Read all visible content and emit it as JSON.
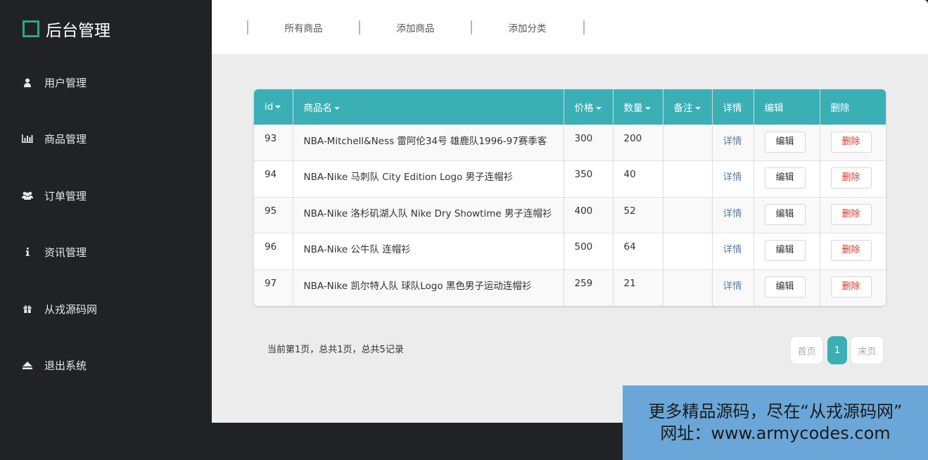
{
  "brand": {
    "title": "后台管理",
    "icon": "square-logo-icon"
  },
  "sidebar": {
    "items": [
      {
        "label": "用户管理",
        "icon": "user-icon"
      },
      {
        "label": "商品管理",
        "icon": "bar-chart-icon"
      },
      {
        "label": "订单管理",
        "icon": "users-icon"
      },
      {
        "label": "资讯管理",
        "icon": "info-icon"
      },
      {
        "label": "从戎源码网",
        "icon": "gift-icon"
      },
      {
        "label": "退出系统",
        "icon": "eject-icon"
      }
    ]
  },
  "topbar": {
    "tabs": [
      "所有商品",
      "添加商品",
      "添加分类"
    ]
  },
  "table": {
    "headers": [
      "id",
      "商品名",
      "价格",
      "数量",
      "备注",
      "详情",
      "编辑",
      "删除"
    ],
    "rows": [
      {
        "id": "93",
        "name": "NBA-Mitchell&Ness 雷阿伦34号 雄鹿队1996-97赛季客",
        "price": "300",
        "qty": "200",
        "note": "",
        "detail": "详情",
        "edit": "编辑",
        "del": "删除"
      },
      {
        "id": "94",
        "name": "NBA-Nike 马刺队 City Edition Logo 男子连帽衫",
        "price": "350",
        "qty": "40",
        "note": "",
        "detail": "详情",
        "edit": "编辑",
        "del": "删除"
      },
      {
        "id": "95",
        "name": "NBA-Nike 洛杉矶湖人队 Nike Dry Showtime 男子连帽衫",
        "price": "400",
        "qty": "52",
        "note": "",
        "detail": "详情",
        "edit": "编辑",
        "del": "删除"
      },
      {
        "id": "96",
        "name": "NBA-Nike 公牛队 连帽衫",
        "price": "500",
        "qty": "64",
        "note": "",
        "detail": "详情",
        "edit": "编辑",
        "del": "删除"
      },
      {
        "id": "97",
        "name": "NBA-Nike 凯尔特人队 球队Logo 黑色男子运动连帽衫",
        "price": "259",
        "qty": "21",
        "note": "",
        "detail": "详情",
        "edit": "编辑",
        "del": "删除"
      }
    ]
  },
  "pagination": {
    "info": "当前第1页，总共1页，总共5记录",
    "first": "首页",
    "current": "1",
    "last": "末页"
  },
  "promo": {
    "line1": "更多精品源码，尽在“从戎源码网”",
    "line2": "网址：www.armycodes.com"
  },
  "colors": {
    "accent": "#3aafb6",
    "sidebar": "#212226",
    "delete": "#d9342a",
    "brand_box": "#2fa77a",
    "promo_bg": "#6aa7d8"
  }
}
